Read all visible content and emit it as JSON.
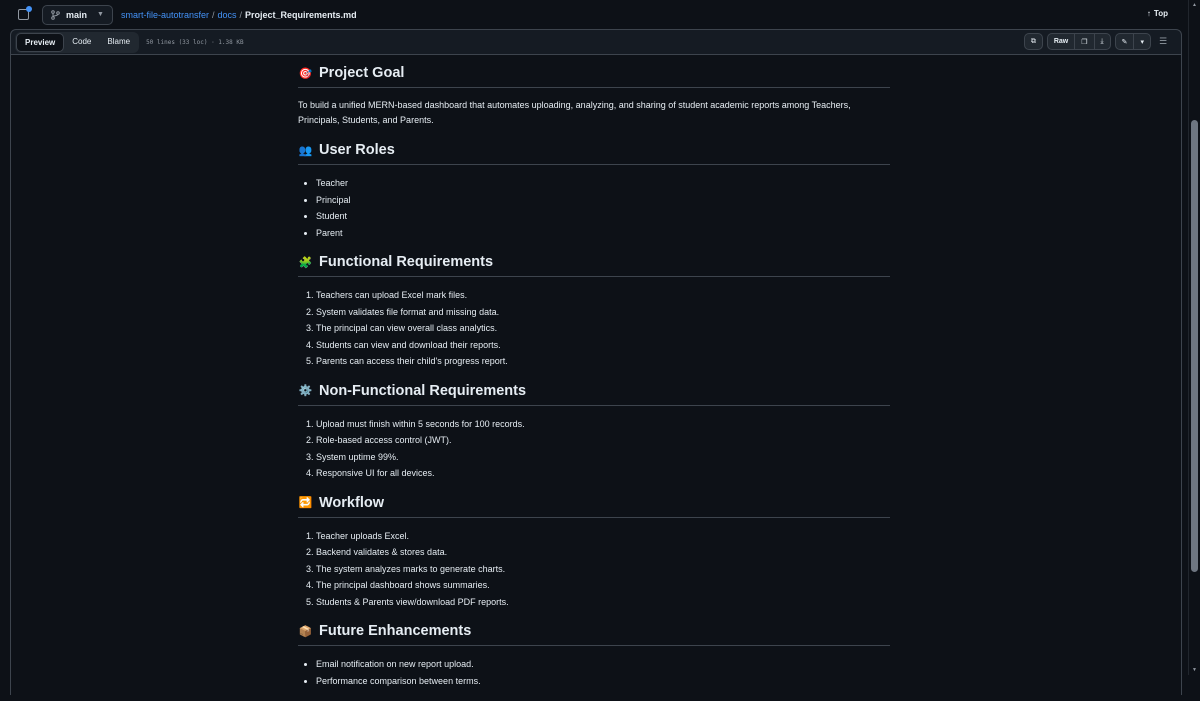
{
  "header": {
    "branch": "main",
    "breadcrumb": {
      "repo": "smart-file-autotransfer",
      "sep1": "/",
      "folder": "docs",
      "sep2": "/",
      "file": "Project_Requirements.md"
    },
    "top_label": "Top"
  },
  "toolbar": {
    "tabs": [
      "Preview",
      "Code",
      "Blame"
    ],
    "meta": "50 lines (33 loc) · 1.38 KB",
    "raw_label": "Raw"
  },
  "sections": [
    {
      "emoji": "🎯",
      "title": "Project Goal",
      "type": "p",
      "text": "To build a unified MERN-based dashboard that automates uploading, analyzing, and sharing of student academic reports among Teachers, Principals, Students, and Parents."
    },
    {
      "emoji": "👥",
      "title": "User Roles",
      "type": "ul",
      "items": [
        "Teacher",
        "Principal",
        "Student",
        "Parent"
      ]
    },
    {
      "emoji": "🧩",
      "title": "Functional Requirements",
      "type": "ol",
      "items": [
        "Teachers can upload Excel mark files.",
        "System validates file format and missing data.",
        "The principal can view overall class analytics.",
        "Students can view and download their reports.",
        "Parents can access their child's progress report."
      ]
    },
    {
      "emoji": "⚙️",
      "title": "Non-Functional Requirements",
      "type": "ol",
      "items": [
        "Upload must finish within 5 seconds for 100 records.",
        "Role-based access control (JWT).",
        "System uptime 99%.",
        "Responsive UI for all devices."
      ]
    },
    {
      "emoji": "🔁",
      "title": "Workflow",
      "type": "ol",
      "items": [
        "Teacher uploads Excel.",
        "Backend validates & stores data.",
        "The system analyzes marks to generate charts.",
        "The principal dashboard shows summaries.",
        "Students & Parents view/download PDF reports."
      ]
    },
    {
      "emoji": "📦",
      "title": "Future Enhancements",
      "type": "ul",
      "items": [
        "Email notification on new report upload.",
        "Performance comparison between terms."
      ]
    }
  ],
  "colors": {
    "accent": "#4493f8",
    "background": "#0d1117",
    "border": "#3d444d"
  }
}
